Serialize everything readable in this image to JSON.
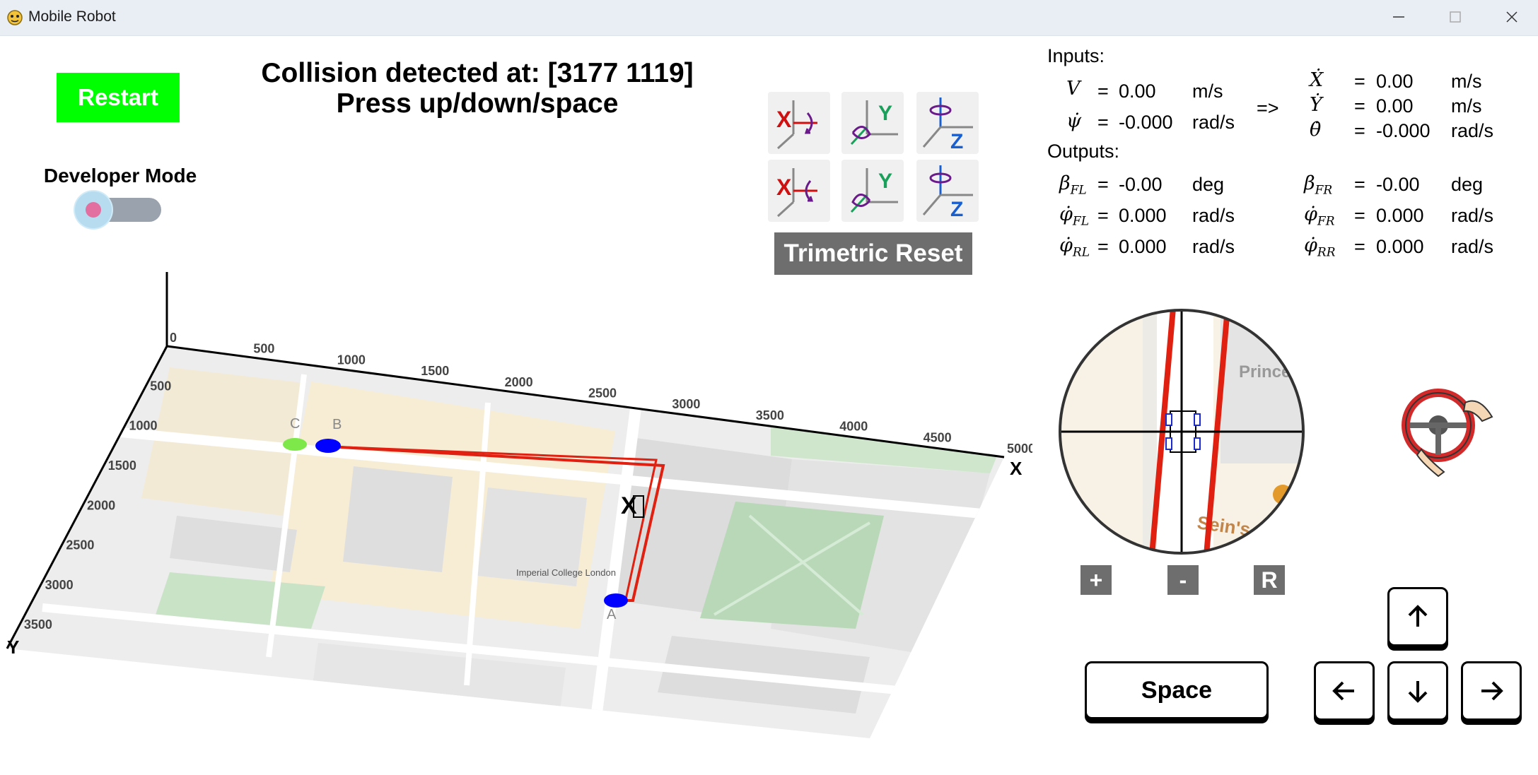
{
  "window": {
    "title": "Mobile Robot"
  },
  "controls": {
    "restart_label": "Restart",
    "developer_mode_label": "Developer Mode",
    "developer_mode_enabled": false,
    "trimetric_reset_label": "Trimetric Reset",
    "zoom_in_label": "+",
    "zoom_out_label": "-",
    "zoom_reset_label": "R",
    "space_label": "Space"
  },
  "status": {
    "line1": "Collision detected at: [3177 1119]",
    "line2": "Press up/down/space"
  },
  "view_buttons": [
    {
      "name": "rotate-x-positive",
      "axis": "X"
    },
    {
      "name": "rotate-y-positive",
      "axis": "Y"
    },
    {
      "name": "rotate-z-positive",
      "axis": "Z"
    },
    {
      "name": "rotate-x-negative",
      "axis": "X"
    },
    {
      "name": "rotate-y-negative",
      "axis": "Y"
    },
    {
      "name": "rotate-z-negative",
      "axis": "Z"
    }
  ],
  "panel": {
    "inputs_label": "Inputs:",
    "outputs_label": "Outputs:",
    "arrow": "=>",
    "eq": "=",
    "inputs": [
      {
        "symbol": "V",
        "value": "0.00",
        "unit": "m/s"
      },
      {
        "symbol": "ψ̇",
        "value": "-0.000",
        "unit": "rad/s"
      }
    ],
    "derived": [
      {
        "symbol": "Ẋ",
        "value": "0.00",
        "unit": "m/s"
      },
      {
        "symbol": "Ẏ",
        "value": "0.00",
        "unit": "m/s"
      },
      {
        "symbol": "θ̇",
        "value": "-0.000",
        "unit": "rad/s"
      }
    ],
    "outputs_left": [
      {
        "symbol": "β",
        "sub": "FL",
        "value": "-0.00",
        "unit": "deg"
      },
      {
        "symbol": "φ̇",
        "sub": "FL",
        "value": "0.000",
        "unit": "rad/s"
      },
      {
        "symbol": "φ̇",
        "sub": "RL",
        "value": "0.000",
        "unit": "rad/s"
      }
    ],
    "outputs_right": [
      {
        "symbol": "β",
        "sub": "FR",
        "value": "-0.00",
        "unit": "deg"
      },
      {
        "symbol": "φ̇",
        "sub": "FR",
        "value": "0.000",
        "unit": "rad/s"
      },
      {
        "symbol": "φ̇",
        "sub": "RR",
        "value": "0.000",
        "unit": "rad/s"
      }
    ]
  },
  "map": {
    "x_ticks": [
      "0",
      "500",
      "1000",
      "1500",
      "2000",
      "2500",
      "3000",
      "3500",
      "4000",
      "4500",
      "5000"
    ],
    "y_ticks": [
      "500",
      "1000",
      "1500",
      "2000",
      "2500",
      "3000",
      "3500"
    ],
    "x_axis_label": "X",
    "y_axis_label": "Y",
    "waypoint_labels": [
      "C",
      "B",
      "A"
    ],
    "place_labels": [
      "Imperial College London"
    ],
    "minimap_text": [
      "Prince",
      "Sein's"
    ]
  },
  "colors": {
    "restart_bg": "#00ff00",
    "button_gray": "#6e6e6e",
    "path_red": "#e02010",
    "waypoint_blue": "#0000ff",
    "waypoint_green": "#7ee84a"
  },
  "icons": {
    "arrow_up": "↑",
    "arrow_left": "←",
    "arrow_down": "↓",
    "arrow_right": "→"
  }
}
